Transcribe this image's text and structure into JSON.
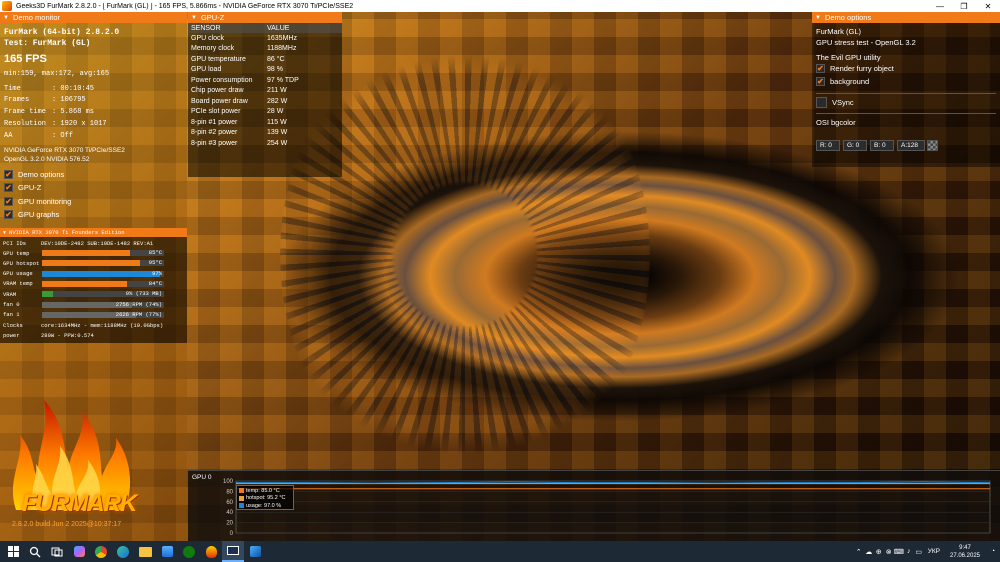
{
  "window": {
    "title": "Geeks3D FurMark 2.8.2.0 - [ FurMark (GL) ] - 165 FPS, 5.866ms - NVIDIA GeForce RTX 3070 Ti/PCIe/SSE2",
    "minimize_glyph": "—",
    "maximize_glyph": "❐",
    "close_glyph": "✕"
  },
  "demo_monitor": {
    "header": "Demo monitor",
    "app_line": "FurMark (64-bit) 2.8.2.0",
    "test_line": "Test: FurMark (GL)",
    "fps": "165 FPS",
    "minmax": "min:159, max:172, avg:165",
    "stats": [
      {
        "k": "Time",
        "v": ": 00:10:45"
      },
      {
        "k": "Frames",
        "v": ": 106795"
      },
      {
        "k": "Frame time",
        "v": ": 5.868 ms"
      },
      {
        "k": "Resolution",
        "v": ": 1920 x 1017"
      },
      {
        "k": "AA",
        "v": ": Off"
      }
    ],
    "gpu_line": "NVIDIA GeForce RTX 3070 Ti/PCIe/SSE2",
    "gl_line": "OpenGL 3.2.0 NVIDIA 576.52",
    "checks": [
      {
        "label": "Demo options",
        "checked": true
      },
      {
        "label": "GPU-Z",
        "checked": true
      },
      {
        "label": "GPU monitoring",
        "checked": true
      },
      {
        "label": "GPU graphs",
        "checked": true
      }
    ]
  },
  "gpu_monitor": {
    "header": "NVIDIA RTX 3070 Ti Founders Edition",
    "pci_label": "PCI IDs",
    "pci_value": "DEV:10DE-2482 SUB:10DE-1482 REV:A1",
    "rows": [
      {
        "label": "GPU temp",
        "value": "85°C",
        "pct": 0.72,
        "color": "#f07a18"
      },
      {
        "label": "GPU hotspot",
        "value": "95°C",
        "pct": 0.8,
        "color": "#f07a18"
      },
      {
        "label": "GPU usage",
        "value": "97%",
        "pct": 0.97,
        "color": "#1e88d8"
      },
      {
        "label": "VRAM temp",
        "value": "84°C",
        "pct": 0.7,
        "color": "#f07a18"
      },
      {
        "label": "VRAM",
        "value": "9% (733 MB)",
        "pct": 0.09,
        "color": "#3a9a3a"
      },
      {
        "label": "fan 0",
        "value": "2756 RPM (74%)",
        "pct": 0.74,
        "color": "#666"
      },
      {
        "label": "fan 1",
        "value": "2626 RPM (77%)",
        "pct": 0.77,
        "color": "#666"
      }
    ],
    "clocks_label": "Clocks",
    "clocks_value": "core:1634MHz - mem:1188MHz (19.0Gbps)",
    "power_label": "power",
    "power_value": "280W - PPW:0.574"
  },
  "build_line": "2.8.2.0 build Jun  2 2025@10:37:17",
  "logo_text": "FURMARK",
  "gpuz": {
    "header": "GPU-Z",
    "col_sensor": "SENSOR",
    "col_value": "VALUE",
    "rows": [
      {
        "sensor": "GPU clock",
        "value": "1635MHz"
      },
      {
        "sensor": "Memory clock",
        "value": "1188MHz"
      },
      {
        "sensor": "GPU temperature",
        "value": "86 °C"
      },
      {
        "sensor": "GPU load",
        "value": "98 %"
      },
      {
        "sensor": "Power consumption",
        "value": "97 % TDP"
      },
      {
        "sensor": "Chip power draw",
        "value": "211 W"
      },
      {
        "sensor": "Board power draw",
        "value": "282 W"
      },
      {
        "sensor": "PCIe slot power",
        "value": "28 W"
      },
      {
        "sensor": "8-pin #1 power",
        "value": "115 W"
      },
      {
        "sensor": "8-pin #2 power",
        "value": "139 W"
      },
      {
        "sensor": "8-pin #3 power",
        "value": "254 W"
      }
    ]
  },
  "demo_options": {
    "header": "Demo options",
    "test_name": "FurMark (GL)",
    "test_desc": "GPU stress test - OpenGL 3.2",
    "utility_line": "The Evil GPU utility",
    "render_furry": "Render furry object",
    "background": "background",
    "vsync": "VSync",
    "osi_label": "OSI bgcolor",
    "r": "R: 0",
    "g": "G: 0",
    "b": "B: 0",
    "a": "A:128"
  },
  "gpu_graph": {
    "title": "GPU 0",
    "legend": [
      {
        "label": "temp: 85.0 °C",
        "color": "#f07a18"
      },
      {
        "label": "hotspot: 95.2 °C",
        "color": "#f0a040"
      },
      {
        "label": "usage: 97.0 %",
        "color": "#1e88d8"
      }
    ],
    "yticks": [
      "100",
      "80",
      "60",
      "40",
      "20",
      "0"
    ]
  },
  "chart_data": {
    "type": "line",
    "ylim": [
      0,
      100
    ],
    "yticks": [
      0,
      20,
      40,
      60,
      80,
      100
    ],
    "series": [
      {
        "name": "temp",
        "values": [
          85,
          85,
          85,
          85,
          85,
          85,
          85,
          85,
          85,
          85,
          85,
          85
        ]
      },
      {
        "name": "hotspot",
        "values": [
          95,
          95,
          95,
          95,
          95,
          95,
          95,
          95,
          95,
          95,
          95,
          95
        ]
      },
      {
        "name": "usage",
        "values": [
          97,
          97,
          96,
          97,
          98,
          97,
          97,
          96,
          97,
          97,
          98,
          97
        ]
      }
    ]
  },
  "taskbar": {
    "lang": "УКР",
    "time": "9:47",
    "date": "27.06.2025"
  }
}
